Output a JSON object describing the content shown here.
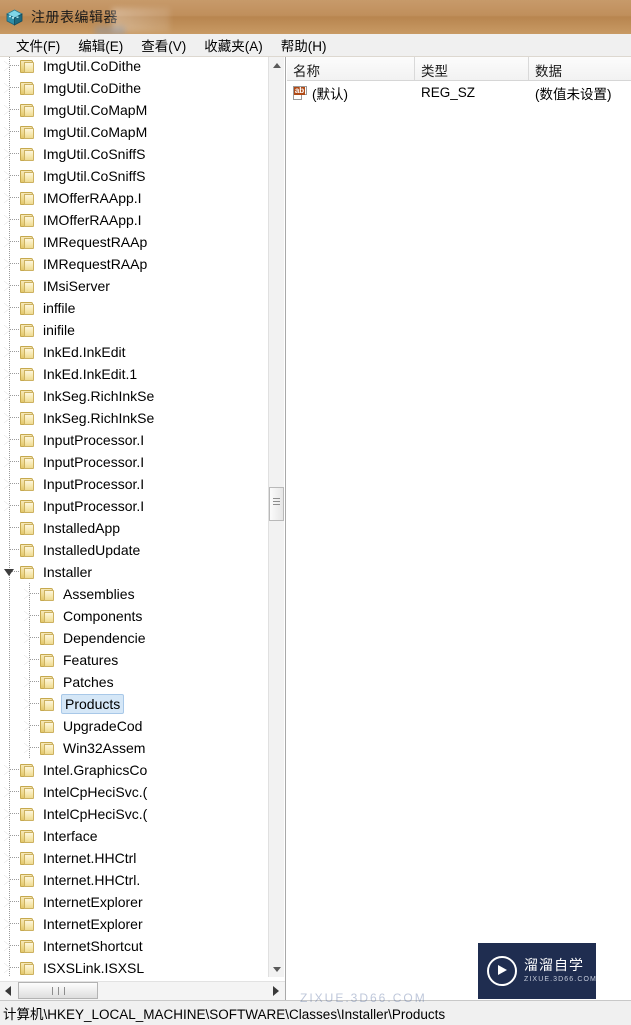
{
  "window": {
    "title": "注册表编辑器",
    "icon": "registry-editor-icon"
  },
  "menubar": {
    "items": [
      {
        "label": "文件(F)",
        "name": "menu-file"
      },
      {
        "label": "编辑(E)",
        "name": "menu-edit"
      },
      {
        "label": "查看(V)",
        "name": "menu-view"
      },
      {
        "label": "收藏夹(A)",
        "name": "menu-favorites"
      },
      {
        "label": "帮助(H)",
        "name": "menu-help"
      }
    ]
  },
  "tree": {
    "nodes": [
      {
        "label": "ImgUtil.CoDithe",
        "depth": 1,
        "state": "collapsed"
      },
      {
        "label": "ImgUtil.CoDithe",
        "depth": 1,
        "state": "collapsed"
      },
      {
        "label": "ImgUtil.CoMapM",
        "depth": 1,
        "state": "collapsed"
      },
      {
        "label": "ImgUtil.CoMapM",
        "depth": 1,
        "state": "collapsed"
      },
      {
        "label": "ImgUtil.CoSniffS",
        "depth": 1,
        "state": "collapsed"
      },
      {
        "label": "ImgUtil.CoSniffS",
        "depth": 1,
        "state": "collapsed"
      },
      {
        "label": "IMOfferRAApp.I",
        "depth": 1,
        "state": "collapsed"
      },
      {
        "label": "IMOfferRAApp.I",
        "depth": 1,
        "state": "collapsed"
      },
      {
        "label": "IMRequestRAAp",
        "depth": 1,
        "state": "collapsed"
      },
      {
        "label": "IMRequestRAAp",
        "depth": 1,
        "state": "collapsed"
      },
      {
        "label": "IMsiServer",
        "depth": 1,
        "state": "collapsed"
      },
      {
        "label": "inffile",
        "depth": 1,
        "state": "collapsed"
      },
      {
        "label": "inifile",
        "depth": 1,
        "state": "collapsed"
      },
      {
        "label": "InkEd.InkEdit",
        "depth": 1,
        "state": "collapsed"
      },
      {
        "label": "InkEd.InkEdit.1",
        "depth": 1,
        "state": "collapsed"
      },
      {
        "label": "InkSeg.RichInkSe",
        "depth": 1,
        "state": "collapsed"
      },
      {
        "label": "InkSeg.RichInkSe",
        "depth": 1,
        "state": "collapsed"
      },
      {
        "label": "InputProcessor.I",
        "depth": 1,
        "state": "collapsed"
      },
      {
        "label": "InputProcessor.I",
        "depth": 1,
        "state": "collapsed"
      },
      {
        "label": "InputProcessor.I",
        "depth": 1,
        "state": "collapsed"
      },
      {
        "label": "InputProcessor.I",
        "depth": 1,
        "state": "collapsed"
      },
      {
        "label": "InstalledApp",
        "depth": 1,
        "state": "leaf"
      },
      {
        "label": "InstalledUpdate",
        "depth": 1,
        "state": "leaf"
      },
      {
        "label": "Installer",
        "depth": 1,
        "state": "expanded"
      },
      {
        "label": "Assemblies",
        "depth": 2,
        "state": "collapsed"
      },
      {
        "label": "Components",
        "depth": 2,
        "state": "collapsed"
      },
      {
        "label": "Dependencie",
        "depth": 2,
        "state": "collapsed"
      },
      {
        "label": "Features",
        "depth": 2,
        "state": "collapsed"
      },
      {
        "label": "Patches",
        "depth": 2,
        "state": "collapsed"
      },
      {
        "label": "Products",
        "depth": 2,
        "state": "collapsed",
        "selected": true
      },
      {
        "label": "UpgradeCod",
        "depth": 2,
        "state": "collapsed"
      },
      {
        "label": "Win32Assem",
        "depth": 2,
        "state": "collapsed"
      },
      {
        "label": "Intel.GraphicsCo",
        "depth": 1,
        "state": "collapsed"
      },
      {
        "label": "IntelCpHeciSvc.(",
        "depth": 1,
        "state": "collapsed"
      },
      {
        "label": "IntelCpHeciSvc.(",
        "depth": 1,
        "state": "collapsed"
      },
      {
        "label": "Interface",
        "depth": 1,
        "state": "collapsed"
      },
      {
        "label": "Internet.HHCtrl",
        "depth": 1,
        "state": "collapsed"
      },
      {
        "label": "Internet.HHCtrl.",
        "depth": 1,
        "state": "collapsed"
      },
      {
        "label": "InternetExplorer",
        "depth": 1,
        "state": "collapsed"
      },
      {
        "label": "InternetExplorer",
        "depth": 1,
        "state": "collapsed"
      },
      {
        "label": "InternetShortcut",
        "depth": 1,
        "state": "collapsed"
      },
      {
        "label": "ISXSLink.ISXSL",
        "depth": 1,
        "state": "collapsed"
      }
    ]
  },
  "listview": {
    "columns": [
      "名称",
      "类型",
      "数据"
    ],
    "rows": [
      {
        "name": "(默认)",
        "type": "REG_SZ",
        "data": "(数值未设置)",
        "icon": "string-value-icon"
      }
    ]
  },
  "statusbar": {
    "path": "计算机\\HKEY_LOCAL_MACHINE\\SOFTWARE\\Classes\\Installer\\Products"
  },
  "watermark": {
    "cn": "溜溜自学",
    "en": "ZIXUE.3D66.COM",
    "ghost": "ZIXUE.3D66.COM"
  },
  "colors": {
    "titlebar": "#c08f5c",
    "selection": "#d5e7f7",
    "selection_border": "#a8c8e8",
    "watermark_bg": "#1f2d50",
    "folder": "#eed98d"
  }
}
